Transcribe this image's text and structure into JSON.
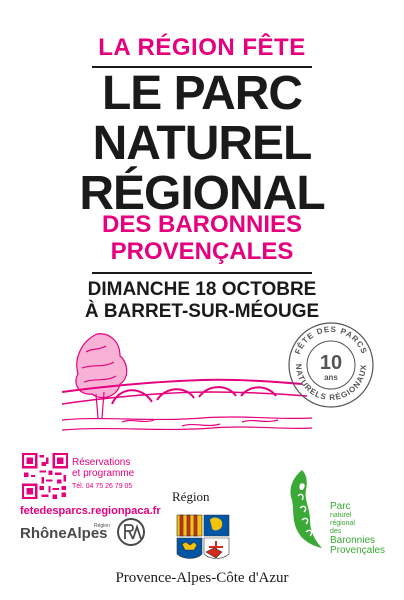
{
  "headline": {
    "top": "LA RÉGION FÊTE",
    "line1": "LE PARC",
    "line2": "NATUREL",
    "line3": "RÉGIONAL",
    "line4": "DES BARONNIES",
    "line5": "PROVENÇALES",
    "date": "DIMANCHE 18 OCTOBRE",
    "place": "À BARRET-SUR-MÉOUGE"
  },
  "stamp": {
    "top_text": "FÊTE DES PARCS",
    "bottom_text": "NATURELS RÉGIONAUX",
    "number": "10",
    "unit": "ans"
  },
  "info": {
    "res_line1": "Réservations",
    "res_line2": "et programme",
    "tel": "Tél. 04 75 26 79 05",
    "url": "fetedesparcs.regionpaca.fr"
  },
  "logos": {
    "rhonealpes": "RhôneAlpes",
    "rhonealpes_region": "Région",
    "region_label": "Région",
    "region_full": "Provence-Alpes-Côte d'Azur",
    "pnr_parc": "Parc",
    "pnr_naturel": "naturel",
    "pnr_regional": "régional",
    "pnr_des": "des",
    "pnr_baronnies": "Baronnies",
    "pnr_provencales": "Provençales"
  },
  "colors": {
    "accent": "#e5007e",
    "text": "#1a1a1a",
    "green": "#3aa935"
  }
}
